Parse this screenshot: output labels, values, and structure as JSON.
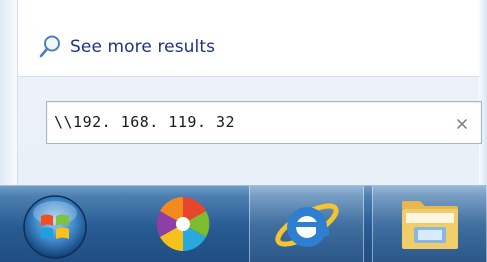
{
  "start_menu": {
    "see_more_label": "See more results",
    "search_value": "\\\\192. 168. 119. 32",
    "clear_symbol": "×"
  },
  "taskbar": {
    "items": [
      {
        "name": "start-orb",
        "icon": "windows-logo-icon"
      },
      {
        "name": "pinned-app",
        "icon": "colorful-flower-icon"
      },
      {
        "name": "internet-explorer",
        "icon": "internet-explorer-icon"
      },
      {
        "name": "windows-explorer",
        "icon": "folder-icon"
      }
    ]
  },
  "colors": {
    "link": "#1e3287",
    "taskbar_top": "#6e9cc6",
    "taskbar_bottom": "#1f4d82",
    "search_border": "#a5b3c6"
  }
}
